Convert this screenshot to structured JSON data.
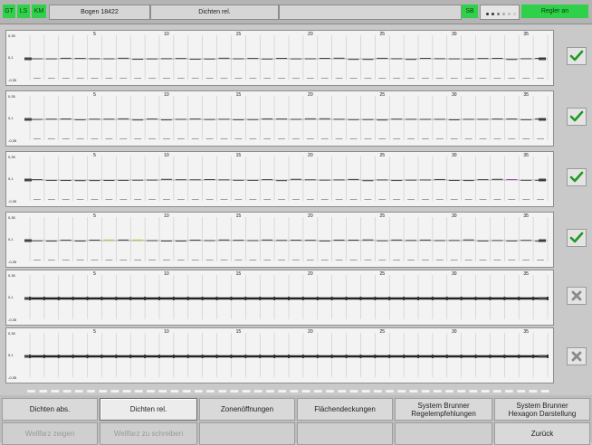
{
  "statusbar": {
    "gt_label": "GT",
    "ls_label": "LS",
    "km_label": "KM",
    "sheet": "Bogen 18422",
    "mode": "Dichten rel.",
    "sb_label": "SB",
    "regler": "Regler an"
  },
  "colors": {
    "accent_green": "#2fd14a",
    "ok_green": "#1f9a1f"
  },
  "axis": {
    "y_top": "0,35",
    "y_mid": "0,1",
    "y_bottom": "-0,35",
    "zone_ticks": [
      "5",
      "10",
      "15",
      "20",
      "25",
      "30",
      "35"
    ]
  },
  "panels": [
    {
      "status_icon": "checkmark-icon"
    },
    {
      "status_icon": "checkmark-icon"
    },
    {
      "status_icon": "checkmark-icon"
    },
    {
      "status_icon": "checkmark-icon"
    },
    {
      "status_icon": "cross-icon"
    },
    {
      "status_icon": "cross-icon"
    }
  ],
  "buttons_row1": [
    "Dichten abs.",
    "Dichten rel.",
    "Zonenöffnungen",
    "Flächendeckungen",
    "System Brunner\nRegelempfehlungen",
    "System Brunner\nHexagon Darstellung"
  ],
  "buttons_row2": [
    "Wellfarz zeigen",
    "Wellfarz zu schreiben",
    "",
    "",
    "",
    "Zurück"
  ]
}
